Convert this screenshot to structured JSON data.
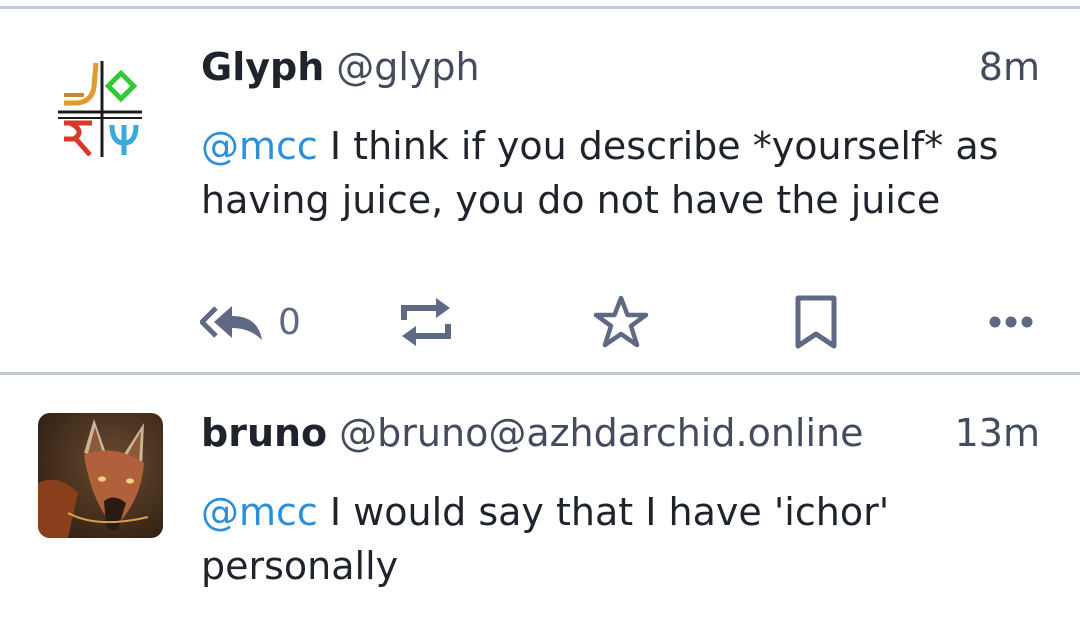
{
  "statuses": [
    {
      "display_name": "Glyph",
      "handle": "@glyph",
      "time": "8m",
      "mention": "@mcc",
      "text": " I think if you describe *yourself* as having juice, you do not have the juice",
      "avatar_icon": "glyph-sigil-avatar",
      "actions": {
        "reply_count": "0",
        "reply_icon": "reply-all-icon",
        "boost_icon": "boost-icon",
        "favourite_icon": "star-icon",
        "bookmark_icon": "bookmark-icon",
        "more_icon": "ellipsis-icon"
      }
    },
    {
      "display_name": "bruno",
      "handle": "@bruno@azhdarchid.online",
      "time": "13m",
      "mention": "@mcc",
      "text": " I would say that I have 'ichor' personally",
      "avatar_icon": "maned-wolf-avatar"
    }
  ],
  "colors": {
    "mention": "#2b90d9",
    "divider": "#c0cdd9",
    "icon": "#606984",
    "text": "#1f232b"
  }
}
